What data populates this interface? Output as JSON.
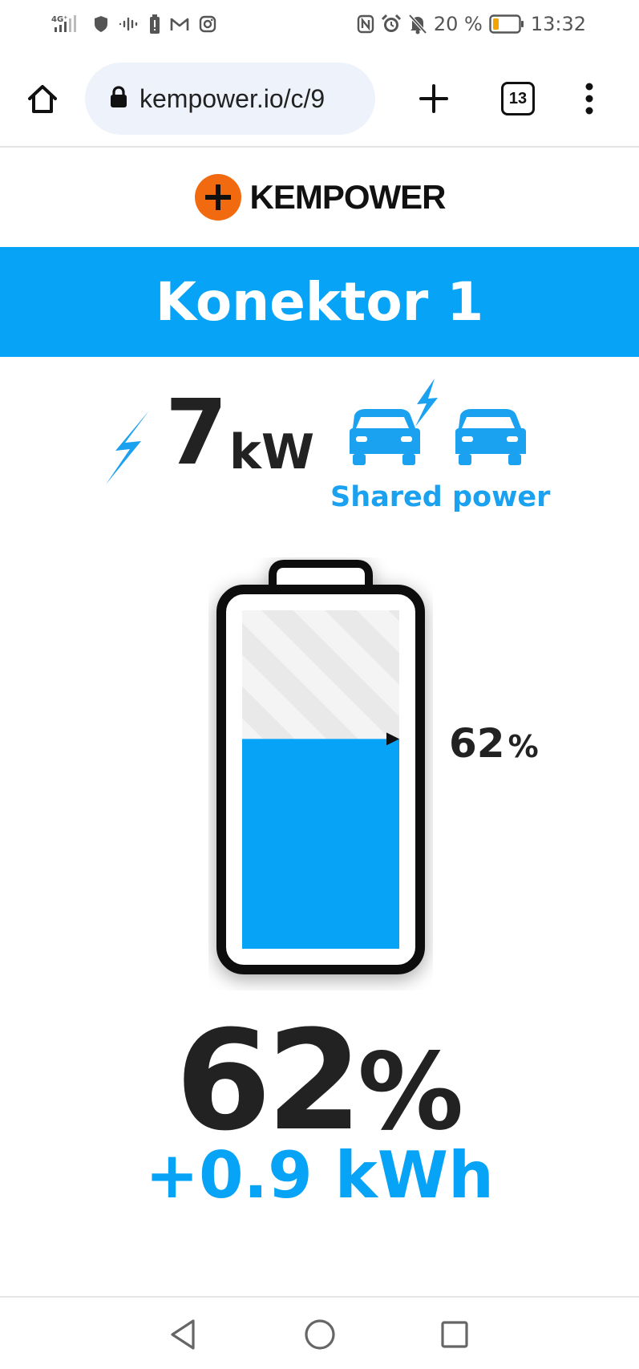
{
  "status_bar": {
    "network": "4G⁺",
    "battery_percent": "20 %",
    "time": "13:32",
    "icons": [
      "signal-icon",
      "shield-icon",
      "soundwave-icon",
      "battery-alert-icon",
      "gmail-icon",
      "instagram-icon",
      "nfc-icon",
      "alarm-icon",
      "bell-off-icon",
      "battery-icon"
    ]
  },
  "browser": {
    "url": "kempower.io/c/9",
    "tab_count": "13"
  },
  "logo": {
    "text": "KEMPOWER",
    "color": "#f26a0f"
  },
  "connector": {
    "title": "Konektor 1",
    "power_value": "7",
    "power_unit": "kW",
    "shared_label": "Shared power"
  },
  "battery": {
    "level": 0.62,
    "level_label": "62",
    "level_unit": "%",
    "fill_color": "#06a3f6"
  },
  "summary": {
    "percent_value": "62",
    "percent_unit": "%",
    "energy": "+0.9 kWh"
  },
  "colors": {
    "accent": "#06a3f6",
    "text": "#222222"
  }
}
